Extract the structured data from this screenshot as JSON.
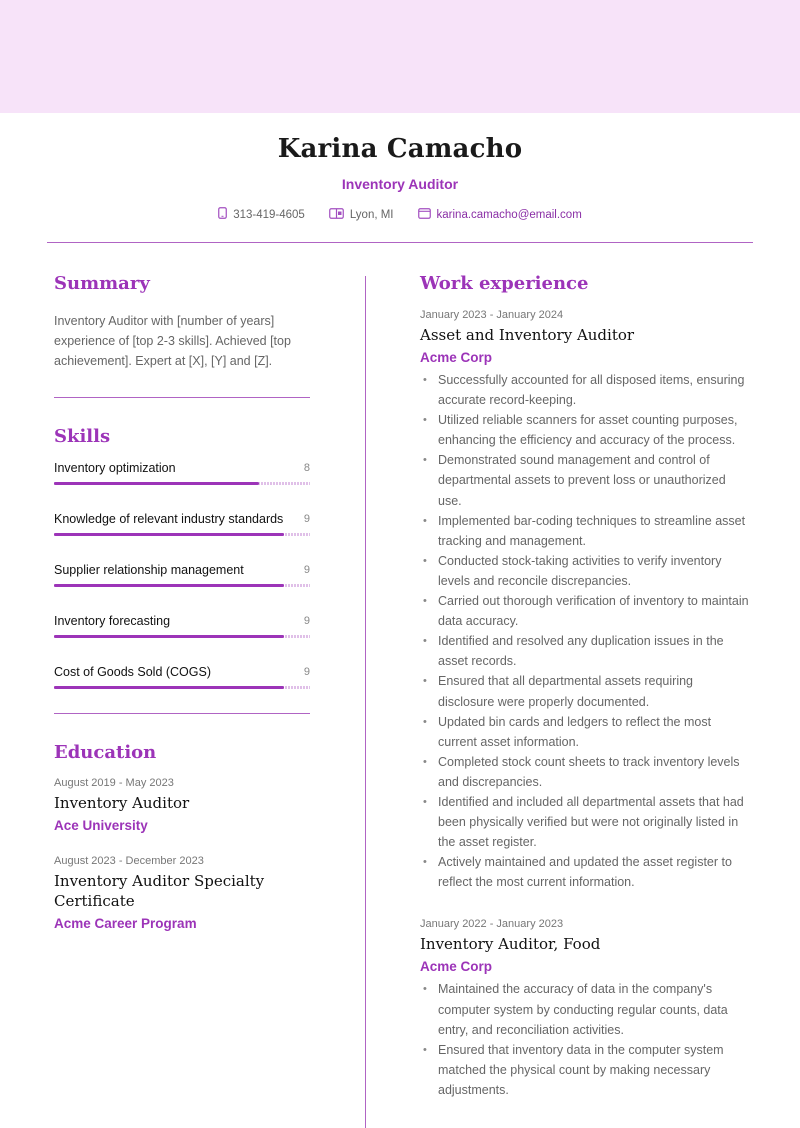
{
  "header": {
    "name": "Karina Camacho",
    "role": "Inventory Auditor",
    "contacts": {
      "phone": {
        "icon": "phone-icon",
        "value": "313-419-4605"
      },
      "location": {
        "icon": "map-icon",
        "value": "Lyon, MI"
      },
      "email": {
        "icon": "mail-icon",
        "value": "karina.camacho@email.com"
      }
    }
  },
  "colors": {
    "accent": "#9c34b8",
    "band": "#f7e3f9",
    "rule": "#b064c4"
  },
  "summary": {
    "title": "Summary",
    "text": "Inventory Auditor with [number of years] experience of [top 2-3 skills]. Achieved [top achievement]. Expert at [X], [Y] and [Z]."
  },
  "skills": {
    "title": "Skills",
    "max": 10,
    "items": [
      {
        "name": "Inventory optimization",
        "value": 8
      },
      {
        "name": "Knowledge of relevant industry standards",
        "value": 9
      },
      {
        "name": "Supplier relationship management",
        "value": 9
      },
      {
        "name": "Inventory forecasting",
        "value": 9
      },
      {
        "name": "Cost of Goods Sold (COGS)",
        "value": 9
      }
    ]
  },
  "education": {
    "title": "Education",
    "items": [
      {
        "date": "August 2019 - May 2023",
        "degree": "Inventory Auditor",
        "school": "Ace University"
      },
      {
        "date": "August 2023 - December 2023",
        "degree": "Inventory Auditor Specialty Certificate",
        "school": "Acme Career Program"
      }
    ]
  },
  "work": {
    "title": "Work experience",
    "items": [
      {
        "date": "January 2023 - January 2024",
        "title": "Asset and Inventory Auditor",
        "company": "Acme Corp",
        "bullets": [
          "Successfully accounted for all disposed items, ensuring accurate record-keeping.",
          "Utilized reliable scanners for asset counting purposes, enhancing the efficiency and accuracy of the process.",
          "Demonstrated sound management and control of departmental assets to prevent loss or unauthorized use.",
          "Implemented bar-coding techniques to streamline asset tracking and management.",
          "Conducted stock-taking activities to verify inventory levels and reconcile discrepancies.",
          "Carried out thorough verification of inventory to maintain data accuracy.",
          "Identified and resolved any duplication issues in the asset records.",
          "Ensured that all departmental assets requiring disclosure were properly documented.",
          "Updated bin cards and ledgers to reflect the most current asset information.",
          "Completed stock count sheets to track inventory levels and discrepancies.",
          "Identified and included all departmental assets that had been physically verified but were not originally listed in the asset register.",
          "Actively maintained and updated the asset register to reflect the most current information."
        ]
      },
      {
        "date": "January 2022 - January 2023",
        "title": "Inventory Auditor, Food",
        "company": "Acme Corp",
        "bullets": [
          "Maintained the accuracy of data in the company's computer system by conducting regular counts, data entry, and reconciliation activities.",
          "Ensured that inventory data in the computer system matched the physical count by making necessary adjustments."
        ]
      }
    ]
  }
}
